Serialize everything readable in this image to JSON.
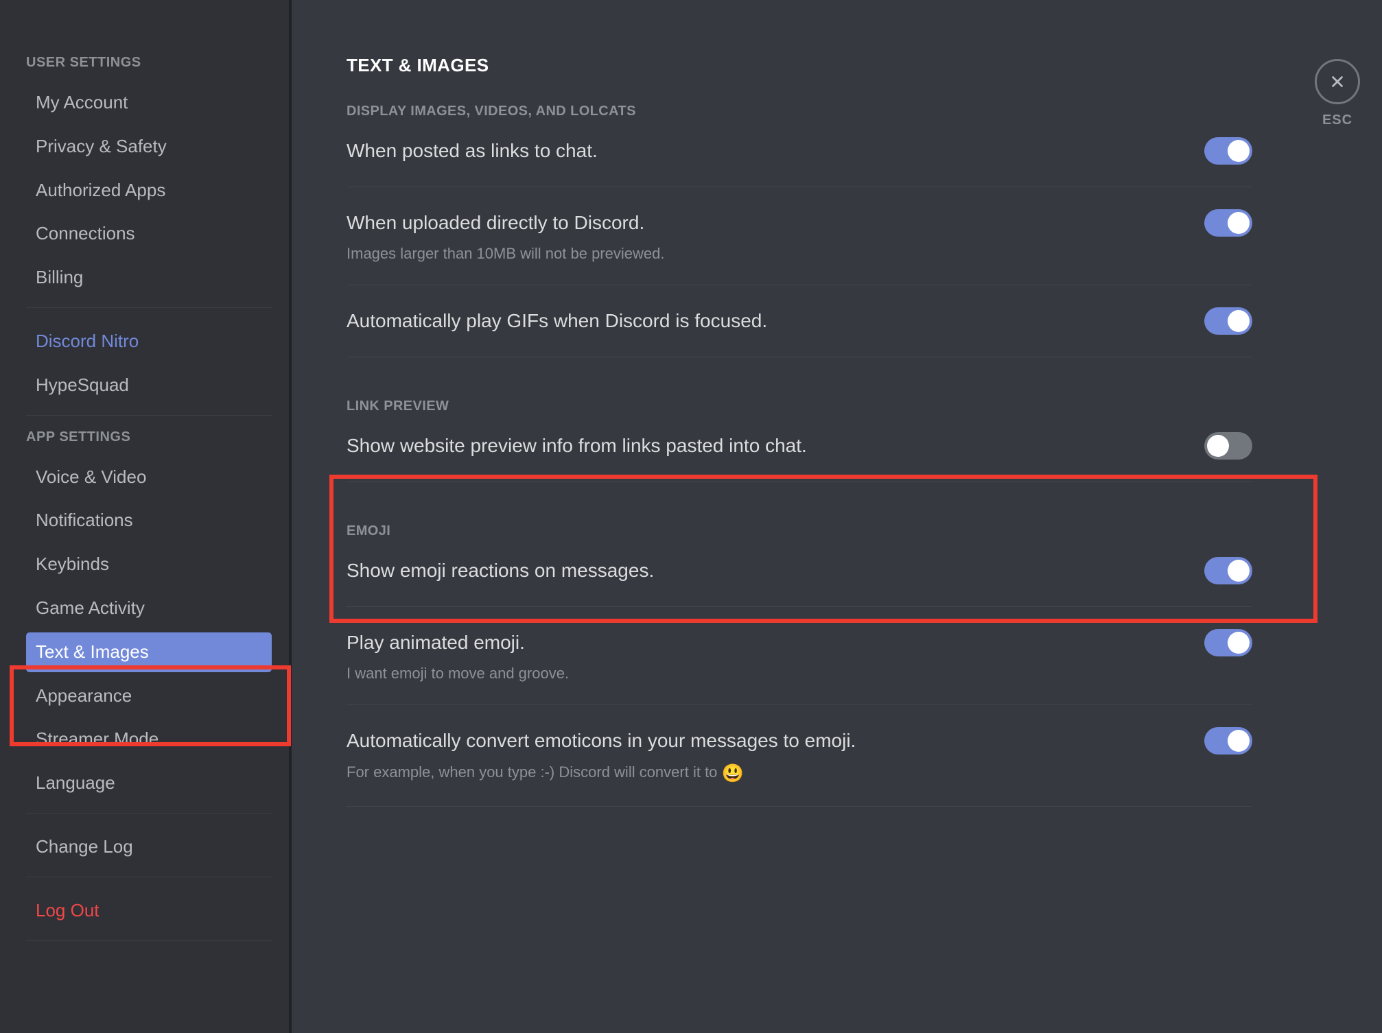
{
  "sidebar": {
    "user_settings_header": "User Settings",
    "user_items": [
      {
        "label": "My Account"
      },
      {
        "label": "Privacy & Safety"
      },
      {
        "label": "Authorized Apps"
      },
      {
        "label": "Connections"
      },
      {
        "label": "Billing"
      }
    ],
    "nitro_label": "Discord Nitro",
    "hypesquad_label": "HypeSquad",
    "app_settings_header": "App Settings",
    "app_items": [
      {
        "label": "Voice & Video"
      },
      {
        "label": "Notifications"
      },
      {
        "label": "Keybinds"
      },
      {
        "label": "Game Activity"
      },
      {
        "label": "Text & Images",
        "selected": true
      },
      {
        "label": "Appearance"
      },
      {
        "label": "Streamer Mode"
      },
      {
        "label": "Language"
      }
    ],
    "changelog_label": "Change Log",
    "logout_label": "Log Out"
  },
  "content": {
    "title": "Text & Images",
    "close_label": "ESC",
    "sections": {
      "display": {
        "header": "Display Images, Videos, and Lolcats",
        "items": [
          {
            "label": "When posted as links to chat.",
            "on": true
          },
          {
            "label": "When uploaded directly to Discord.",
            "note": "Images larger than 10MB will not be previewed.",
            "on": true
          },
          {
            "label": "Automatically play GIFs when Discord is focused.",
            "on": true
          }
        ]
      },
      "link_preview": {
        "header": "Link Preview",
        "items": [
          {
            "label": "Show website preview info from links pasted into chat.",
            "on": false
          }
        ]
      },
      "emoji": {
        "header": "Emoji",
        "items": [
          {
            "label": "Show emoji reactions on messages.",
            "on": true
          },
          {
            "label": "Play animated emoji.",
            "note": "I want emoji to move and groove.",
            "on": true
          },
          {
            "label": "Automatically convert emoticons in your messages to emoji.",
            "note_prefix": "For example, when you type :-) Discord will convert it to ",
            "note_emoji": "😃",
            "on": true
          }
        ]
      }
    }
  }
}
